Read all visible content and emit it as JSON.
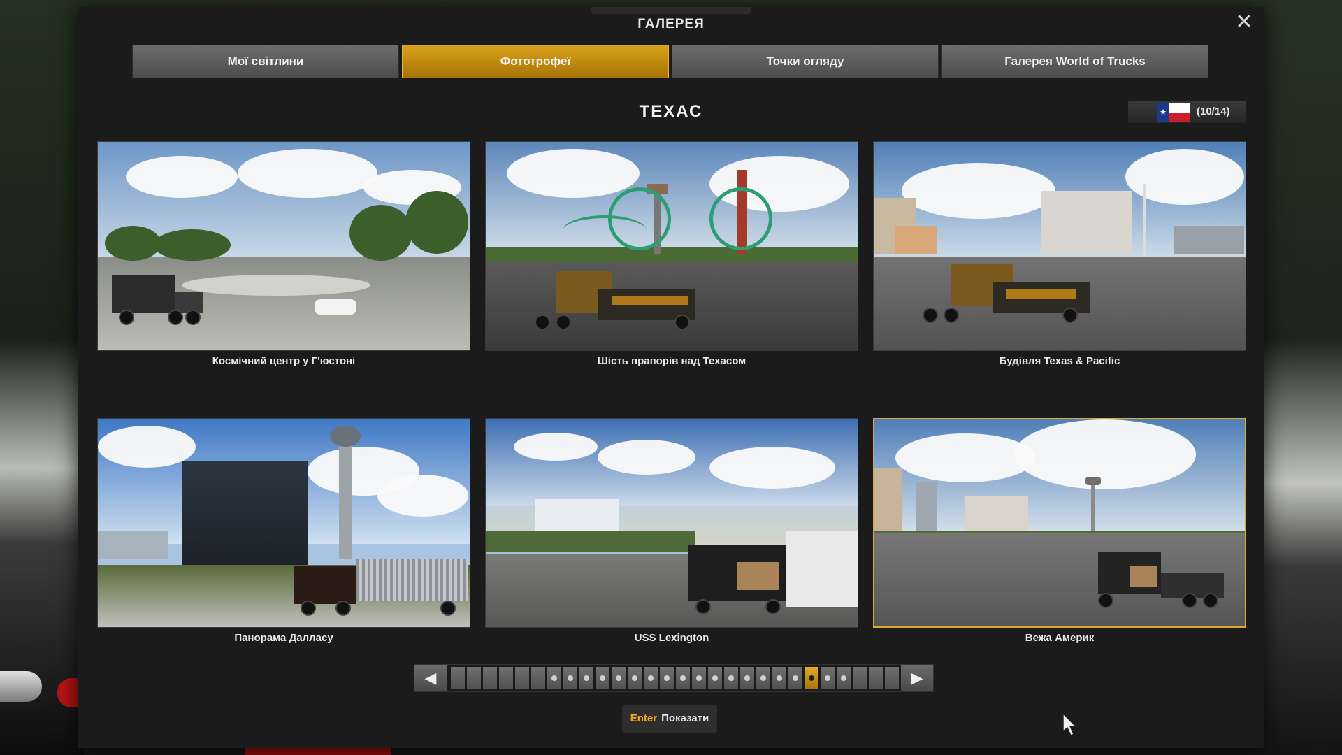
{
  "window": {
    "title": "ГАЛЕРЕЯ",
    "close_icon": "close-icon"
  },
  "tabs": [
    {
      "label": "Мої світлини",
      "active": false
    },
    {
      "label": "Фототрофеї",
      "active": true
    },
    {
      "label": "Точки огляду",
      "active": false
    },
    {
      "label": "Галерея World of Trucks",
      "active": false
    }
  ],
  "region": {
    "name": "ТЕХАС",
    "flag_icon": "texas-flag-icon",
    "progress": "(10/14)"
  },
  "gallery": [
    {
      "label": "Космічний центр у Г'юстоні",
      "selected": false
    },
    {
      "label": "Шість прапорів над Техасом",
      "selected": false
    },
    {
      "label": "Будівля Texas & Pacific",
      "selected": false
    },
    {
      "label": "Панорама Далласу",
      "selected": false
    },
    {
      "label": "USS Lexington",
      "selected": false
    },
    {
      "label": "Вежа Америк",
      "selected": true
    }
  ],
  "pager": {
    "prev_icon": "arrow-left-icon",
    "next_icon": "arrow-right-icon",
    "segment_count": 28,
    "active_segment": 23
  },
  "action": {
    "key": "Enter",
    "label": "Показати"
  },
  "colors": {
    "accent": "#e2a62a",
    "tab_inactive": "#5c5c5c",
    "panel": "#1b1b1b"
  }
}
